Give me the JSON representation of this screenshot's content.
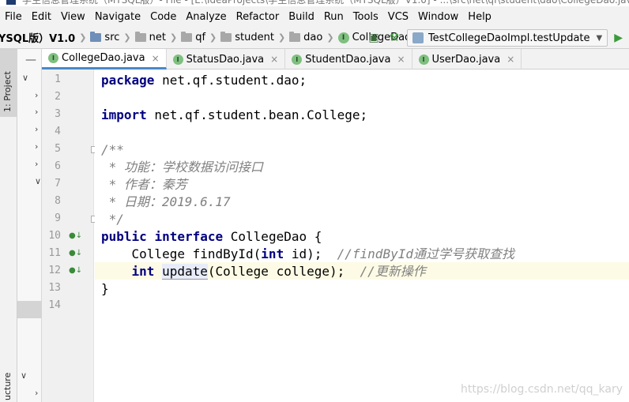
{
  "window": {
    "title_partial": "学生信息管理系统（MYSQL版）- File - [E:\\IdeaProjects\\学生信息管理系统（MYSQL版）V1.0] - ...\\src\\net\\qf\\student\\dao\\CollegeDao.java"
  },
  "menu": [
    "File",
    "Edit",
    "View",
    "Navigate",
    "Code",
    "Analyze",
    "Refactor",
    "Build",
    "Run",
    "Tools",
    "VCS",
    "Window",
    "Help"
  ],
  "breadcrumb": {
    "project": "YSQL版）V1.0",
    "items": [
      "src",
      "net",
      "qf",
      "student",
      "dao",
      "CollegeDao"
    ]
  },
  "run_config": {
    "label": "TestCollegeDaoImpl.testUpdate"
  },
  "tool_windows": {
    "project_label": "1: Project",
    "structure_label": "ucture"
  },
  "tabs": [
    {
      "label": "CollegeDao.java",
      "active": true
    },
    {
      "label": "StatusDao.java",
      "active": false
    },
    {
      "label": "StudentDao.java",
      "active": false
    },
    {
      "label": "UserDao.java",
      "active": false
    }
  ],
  "line_numbers": [
    "1",
    "2",
    "3",
    "4",
    "5",
    "6",
    "7",
    "8",
    "9",
    "10",
    "11",
    "12",
    "13",
    "14"
  ],
  "code": {
    "l1_kw": "package",
    "l1_rest": " net.qf.student.dao;",
    "l3_kw": "import",
    "l3_rest": " net.qf.student.bean.College;",
    "l5": "/**",
    "l6": " * 功能：学校数据访问接口",
    "l7": " * 作者：秦芳",
    "l8": " * 日期：2019.6.17",
    "l9": " */",
    "l10_kw1": "public",
    "l10_kw2": "interface",
    "l10_rest": " CollegeDao {",
    "l11_type": "    College findById(",
    "l11_kw": "int",
    "l11_rest": " id);  ",
    "l11_comment": "//findById通过学号获取查找",
    "l12_indent": "    ",
    "l12_kw": "int",
    "l12_method": "update",
    "l12_rest": "(College college);  ",
    "l12_comment": "//更新操作",
    "l13": "}"
  },
  "watermark": "https://blog.csdn.net/qq_kary",
  "colors": {
    "keyword": "#000080",
    "comment": "#808080",
    "current_line": "#fdfbe5",
    "tab_active_underline": "#4a88c7"
  }
}
